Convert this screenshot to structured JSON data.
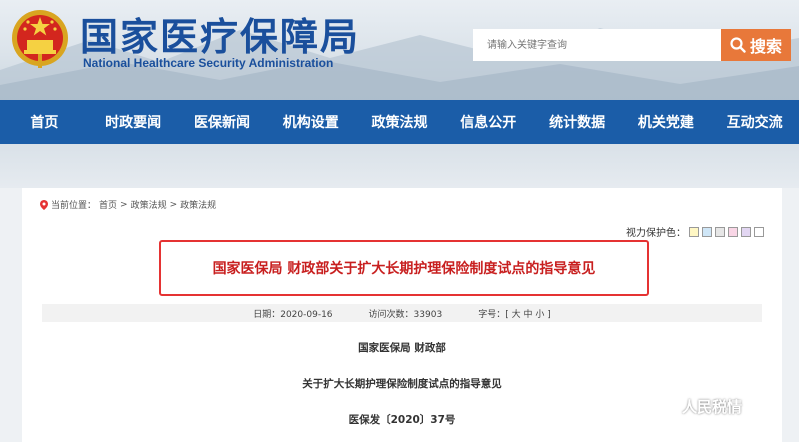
{
  "header": {
    "cn_title": "国家医疗保障局",
    "en_title": "National Healthcare Security Administration"
  },
  "search": {
    "placeholder": "请输入关键字查询",
    "button_label": "搜索"
  },
  "nav": {
    "items": [
      "首页",
      "时政要闻",
      "医保新闻",
      "机构设置",
      "政策法规",
      "信息公开",
      "统计数据",
      "机关党建",
      "互动交流"
    ]
  },
  "breadcrumb": {
    "prefix": "当前位置：",
    "items": [
      "首页",
      "政策法规",
      "政策法规"
    ],
    "separator": ">"
  },
  "vision": {
    "label": "视力保护色：",
    "colors": [
      "#fff7c4",
      "#cfe6f7",
      "#e6e6e6",
      "#f9d6e6",
      "#e2d6f2",
      "#ffffff"
    ]
  },
  "article": {
    "title": "国家医保局 财政部关于扩大长期护理保险制度试点的指导意见",
    "date_label": "日期：",
    "date": "2020-09-16",
    "visits_label": "访问次数：",
    "visits": "33903",
    "font_label": "字号：",
    "font_open": "[",
    "font_sizes": [
      "大",
      "中",
      "小"
    ],
    "font_close": "]",
    "issuer": "国家医保局  财政部",
    "subtitle": "关于扩大长期护理保险制度试点的指导意见",
    "doc_no": "医保发〔2020〕37号"
  },
  "watermark": {
    "text": "人民税情"
  },
  "colors": {
    "nav_bg": "#1b5da8",
    "search_btn": "#e8783a",
    "title_red": "#c81f1f",
    "title_border": "#e53333"
  }
}
